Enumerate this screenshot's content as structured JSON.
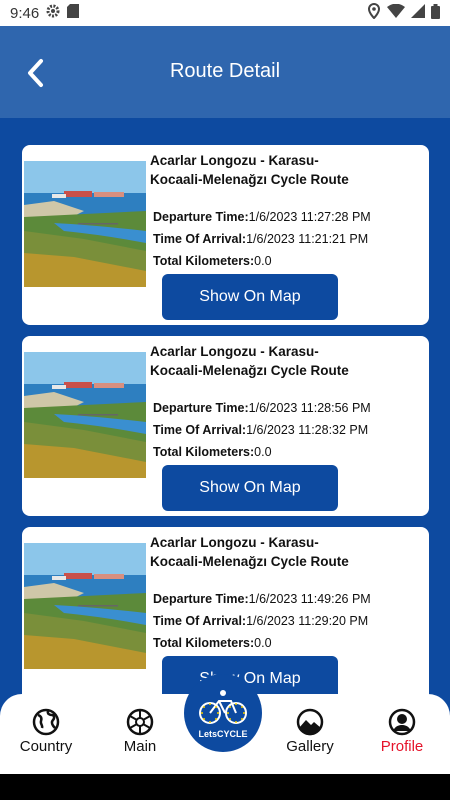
{
  "status": {
    "time": "9:46"
  },
  "header": {
    "title": "Route Detail"
  },
  "routes": [
    {
      "title": "Acarlar Longozu - Karasu-Kocaali-Melenağzı Cycle Route",
      "departure_label": "Departure Time:",
      "departure_value": "1/6/2023 11:27:28 PM",
      "arrival_label": "Time Of Arrival:",
      "arrival_value": "1/6/2023 11:21:21 PM",
      "km_label": "Total Kilometers:",
      "km_value": "0.0",
      "button_label": "Show On Map"
    },
    {
      "title": "Acarlar Longozu - Karasu-Kocaali-Melenağzı Cycle Route",
      "departure_label": "Departure Time:",
      "departure_value": "1/6/2023 11:28:56 PM",
      "arrival_label": "Time Of Arrival:",
      "arrival_value": "1/6/2023 11:28:32 PM",
      "km_label": "Total Kilometers:",
      "km_value": "0.0",
      "button_label": "Show On Map"
    },
    {
      "title": "Acarlar Longozu - Karasu-Kocaali-Melenağzı Cycle Route",
      "departure_label": "Departure Time:",
      "departure_value": "1/6/2023 11:49:26 PM",
      "arrival_label": "Time Of Arrival:",
      "arrival_value": "1/6/2023 11:29:20 PM",
      "km_label": "Total Kilometers:",
      "km_value": "0.0",
      "button_label": "Show On Map"
    }
  ],
  "bottom_nav": {
    "items": [
      {
        "label": "Country",
        "icon": "globe-icon"
      },
      {
        "label": "Main",
        "icon": "aperture-icon"
      },
      {
        "label": "Gallery",
        "icon": "mountain-icon"
      },
      {
        "label": "Profile",
        "icon": "person-icon",
        "active": true
      }
    ],
    "center_logo": "LetsCYCLE"
  },
  "colors": {
    "primary": "#0d4aa0",
    "appbar": "#2f66ae",
    "active": "#e5132a"
  }
}
